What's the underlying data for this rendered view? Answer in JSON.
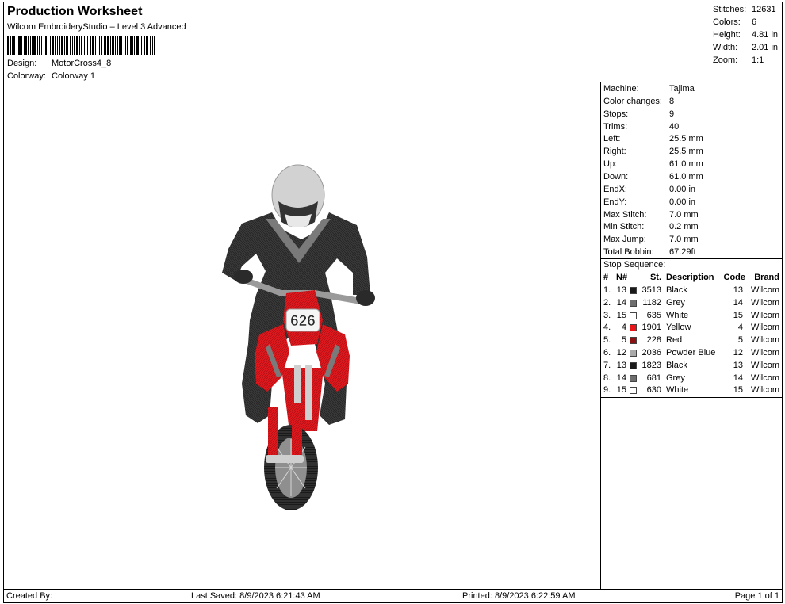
{
  "header": {
    "title": "Production Worksheet",
    "subtitle": "Wilcom EmbroideryStudio – Level 3 Advanced",
    "design_label": "Design:",
    "design_value": "MotorCross4_8",
    "colorway_label": "Colorway:",
    "colorway_value": "Colorway 1"
  },
  "summary": [
    {
      "label": "Stitches:",
      "value": "12631"
    },
    {
      "label": "Colors:",
      "value": "6"
    },
    {
      "label": "Height:",
      "value": "4.81 in"
    },
    {
      "label": "Width:",
      "value": "2.01 in"
    },
    {
      "label": "Zoom:",
      "value": "1:1"
    }
  ],
  "properties": [
    {
      "label": "Machine:",
      "value": "Tajima"
    },
    {
      "label": "Color changes:",
      "value": "8"
    },
    {
      "label": "Stops:",
      "value": "9"
    },
    {
      "label": "Trims:",
      "value": "40"
    },
    {
      "label": "Left:",
      "value": "25.5 mm"
    },
    {
      "label": "Right:",
      "value": "25.5 mm"
    },
    {
      "label": "Up:",
      "value": "61.0 mm"
    },
    {
      "label": "Down:",
      "value": "61.0 mm"
    },
    {
      "label": "EndX:",
      "value": "0.00 in"
    },
    {
      "label": "EndY:",
      "value": "0.00 in"
    },
    {
      "label": "Max Stitch:",
      "value": "7.0 mm"
    },
    {
      "label": "Min Stitch:",
      "value": "0.2 mm"
    },
    {
      "label": "Max Jump:",
      "value": "7.0 mm"
    },
    {
      "label": "Total Bobbin:",
      "value": "67.29ft"
    }
  ],
  "stop_sequence": {
    "title": "Stop Sequence:",
    "columns": {
      "num": "#",
      "n": "N#",
      "st": "St.",
      "description": "Description",
      "code": "Code",
      "brand": "Brand"
    },
    "rows": [
      {
        "num": "1.",
        "n": "13",
        "color": "#1a1a1a",
        "st": "3513",
        "description": "Black",
        "code": "13",
        "brand": "Wilcom"
      },
      {
        "num": "2.",
        "n": "14",
        "color": "#6e6e6e",
        "st": "1182",
        "description": "Grey",
        "code": "14",
        "brand": "Wilcom"
      },
      {
        "num": "3.",
        "n": "15",
        "color": "#ffffff",
        "st": "635",
        "description": "White",
        "code": "15",
        "brand": "Wilcom"
      },
      {
        "num": "4.",
        "n": "4",
        "color": "#e8161b",
        "st": "1901",
        "description": "Yellow",
        "code": "4",
        "brand": "Wilcom"
      },
      {
        "num": "5.",
        "n": "5",
        "color": "#8b1212",
        "st": "228",
        "description": "Red",
        "code": "5",
        "brand": "Wilcom"
      },
      {
        "num": "6.",
        "n": "12",
        "color": "#a9a9a9",
        "st": "2036",
        "description": "Powder Blue",
        "code": "12",
        "brand": "Wilcom"
      },
      {
        "num": "7.",
        "n": "13",
        "color": "#1a1a1a",
        "st": "1823",
        "description": "Black",
        "code": "13",
        "brand": "Wilcom"
      },
      {
        "num": "8.",
        "n": "14",
        "color": "#6e6e6e",
        "st": "681",
        "description": "Grey",
        "code": "14",
        "brand": "Wilcom"
      },
      {
        "num": "9.",
        "n": "15",
        "color": "#ffffff",
        "st": "630",
        "description": "White",
        "code": "15",
        "brand": "Wilcom"
      }
    ]
  },
  "design_image": {
    "plate_number": "626"
  },
  "footer": {
    "created_by": "Created By:",
    "last_saved": "Last Saved: 8/9/2023 6:21:43 AM",
    "printed": "Printed: 8/9/2023 6:22:59 AM",
    "page": "Page 1 of 1"
  }
}
